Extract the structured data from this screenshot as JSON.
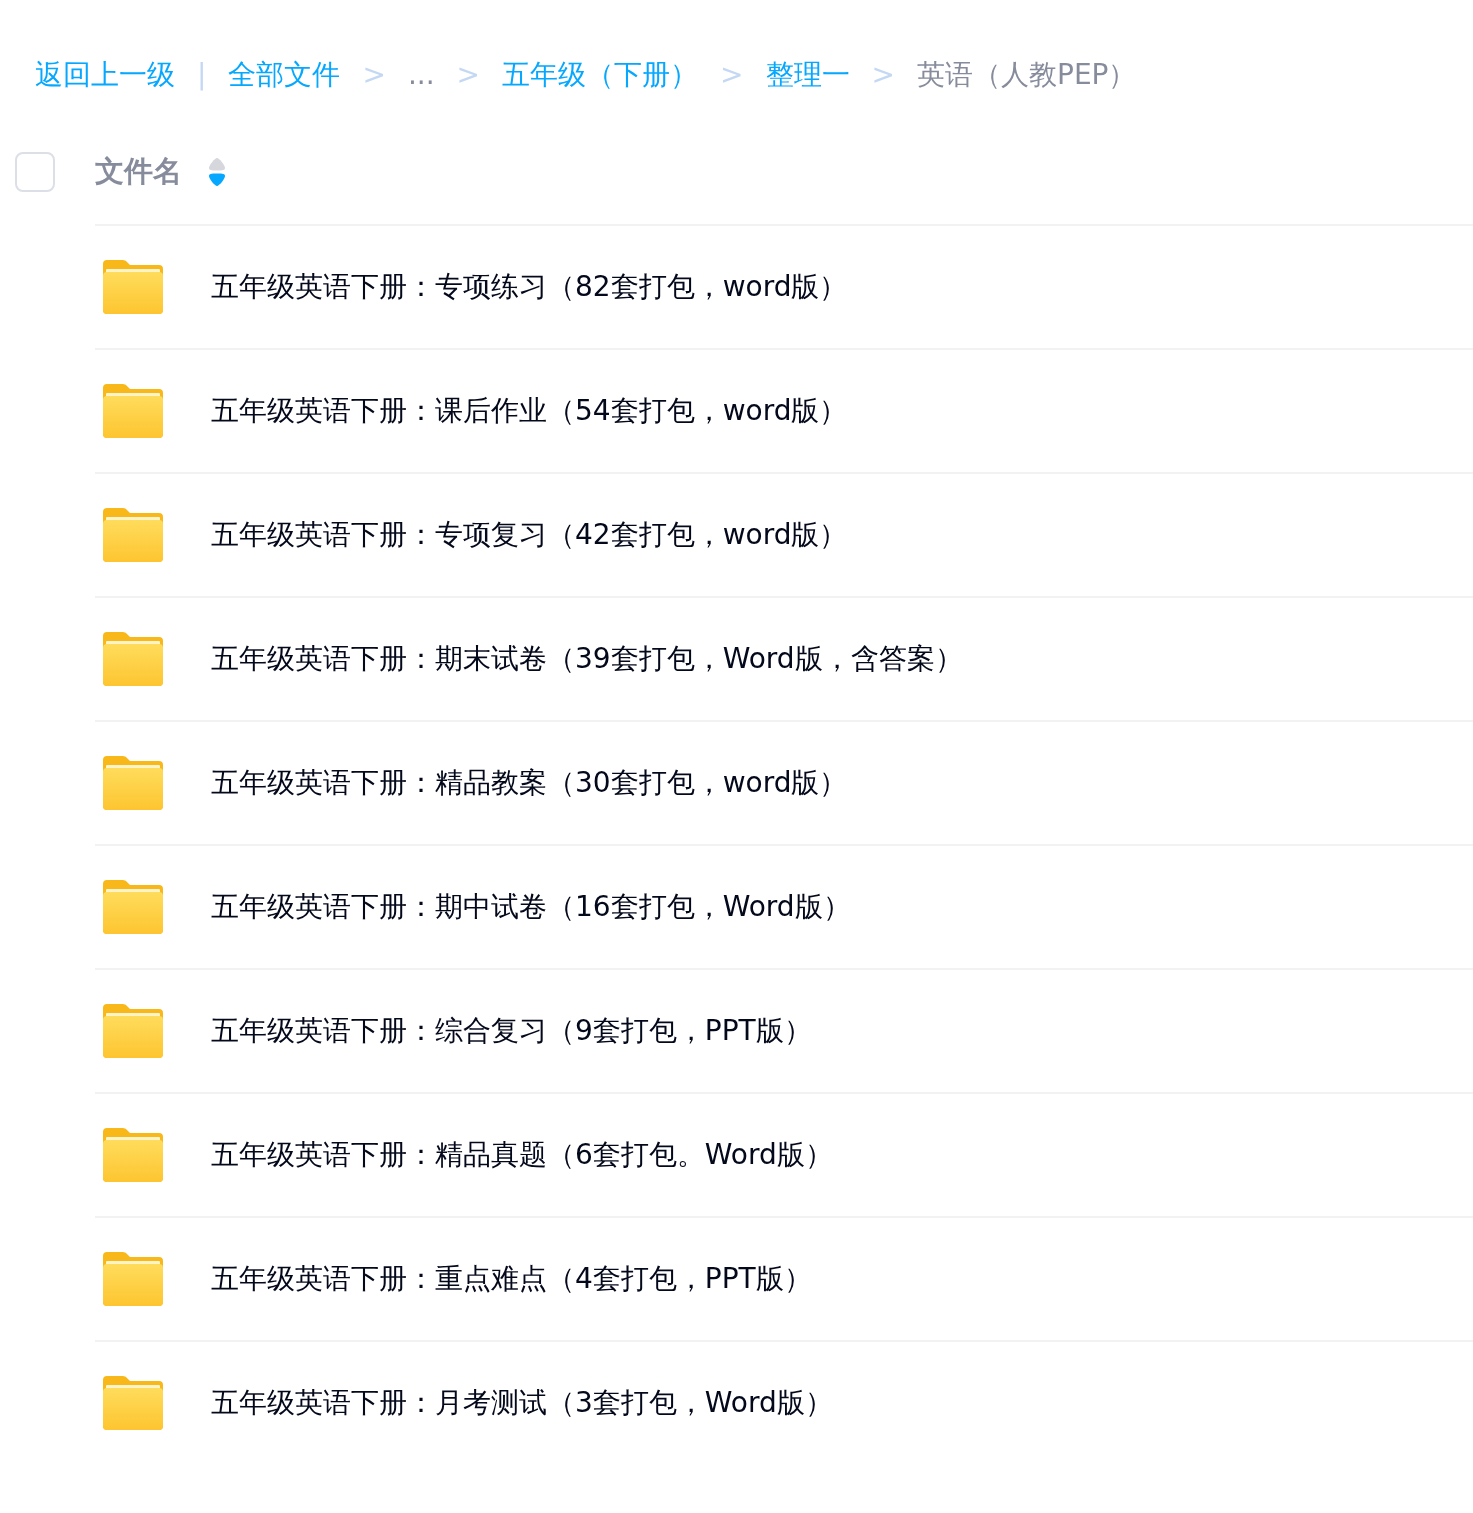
{
  "breadcrumb": {
    "back": "返回上一级",
    "divider": "|",
    "items": [
      {
        "label": "全部文件",
        "kind": "link"
      },
      {
        "label": "...",
        "kind": "ellipsis"
      },
      {
        "label": "五年级（下册）",
        "kind": "link"
      },
      {
        "label": "整理一",
        "kind": "link"
      },
      {
        "label": "英语（人教PEP）",
        "kind": "current"
      }
    ],
    "separator": ">"
  },
  "header": {
    "checked": false,
    "column": "文件名",
    "sort_descending": true
  },
  "files": [
    {
      "name": "五年级英语下册：专项练习（82套打包，word版）"
    },
    {
      "name": "五年级英语下册：课后作业（54套打包，word版）"
    },
    {
      "name": "五年级英语下册：专项复习（42套打包，word版）"
    },
    {
      "name": "五年级英语下册：期末试卷（39套打包，Word版，含答案）"
    },
    {
      "name": "五年级英语下册：精品教案（30套打包，word版）"
    },
    {
      "name": "五年级英语下册：期中试卷（16套打包，Word版）"
    },
    {
      "name": "五年级英语下册：综合复习（9套打包，PPT版）"
    },
    {
      "name": "五年级英语下册：精品真题（6套打包。Word版）"
    },
    {
      "name": "五年级英语下册：重点难点（4套打包，PPT版）"
    },
    {
      "name": "五年级英语下册：月考测试（3套打包，Word版）"
    }
  ]
}
